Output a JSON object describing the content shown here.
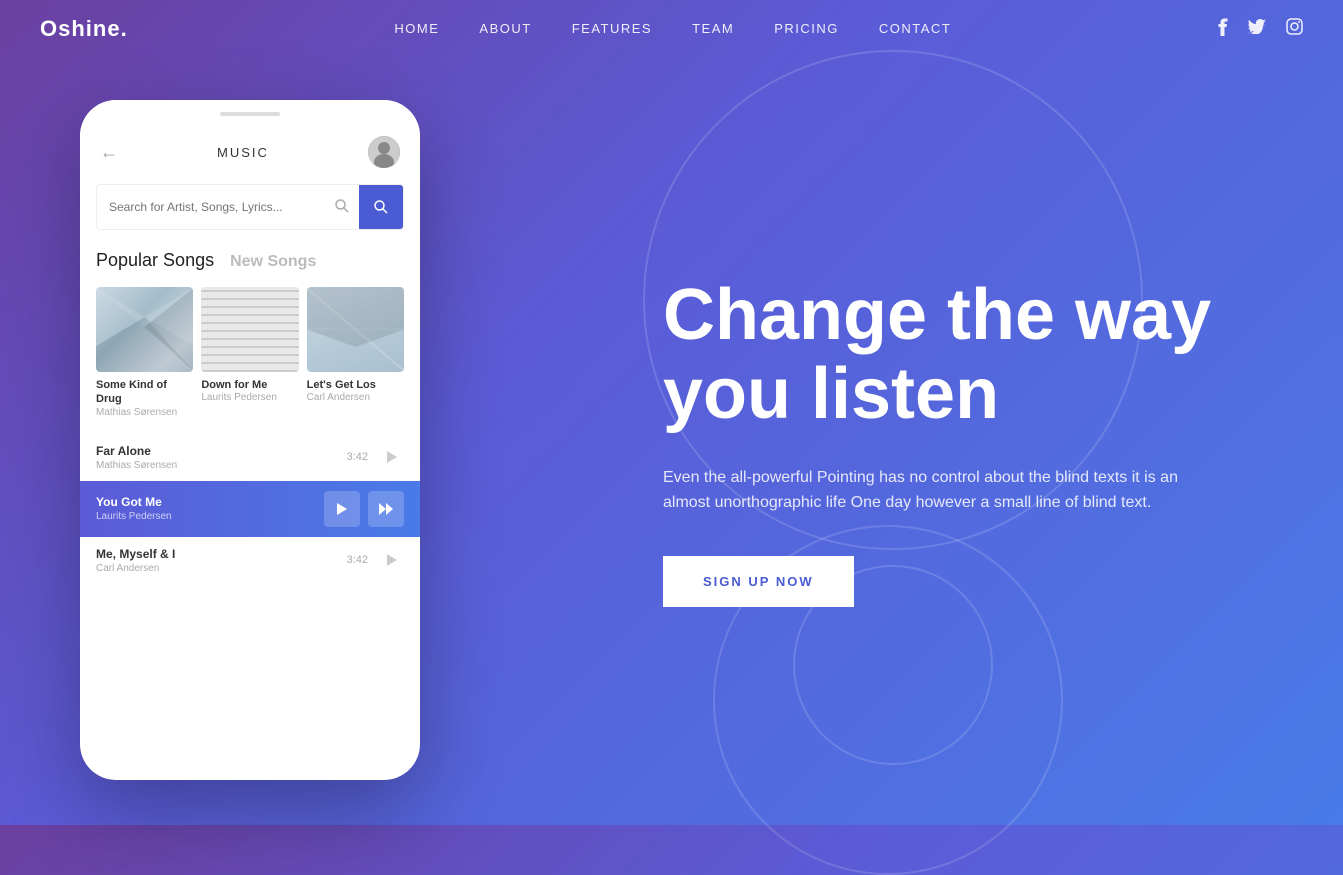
{
  "brand": {
    "logo": "Oshine."
  },
  "nav": {
    "links": [
      {
        "label": "HOME",
        "id": "home"
      },
      {
        "label": "ABOUT",
        "id": "about"
      },
      {
        "label": "FEATURES",
        "id": "features"
      },
      {
        "label": "TEAM",
        "id": "team"
      },
      {
        "label": "PRICING",
        "id": "pricing"
      },
      {
        "label": "CONTACT",
        "id": "contact"
      }
    ],
    "social": [
      {
        "icon": "f",
        "name": "facebook-icon"
      },
      {
        "icon": "t",
        "name": "twitter-icon"
      },
      {
        "icon": "i",
        "name": "instagram-icon"
      }
    ]
  },
  "phone": {
    "header_title": "MUSIC",
    "search_placeholder": "Search for Artist, Songs, Lyrics...",
    "tab_popular_bold": "Popular",
    "tab_popular_light": " Songs",
    "tab_new_bold": "New",
    "tab_new_light": " Songs",
    "cards": [
      {
        "title_bold": "Some",
        "title_rest": " Kind of Drug",
        "artist": "Mathias Sørensen"
      },
      {
        "title_bold": "Down",
        "title_rest": " for Me",
        "artist": "Laurits Pedersen"
      },
      {
        "title_bold": "Let's",
        "title_rest": " Get Los",
        "artist": "Carl Andersen"
      }
    ],
    "playlist": [
      {
        "name_bold": "Far",
        "name_rest": " Alone",
        "artist": "Mathias Sørensen",
        "duration": "3:42",
        "active": false
      },
      {
        "name_bold": "You",
        "name_rest": " Got Me",
        "artist": "Laurits Pedersen",
        "duration": "",
        "active": true
      },
      {
        "name_bold": "Me,",
        "name_rest": " Myself & I",
        "artist": "Carl Andersen",
        "duration": "3:42",
        "active": false
      }
    ]
  },
  "hero": {
    "title_line1": "Change the way",
    "title_line2": "you listen",
    "description": "Even the all-powerful Pointing has no control about the blind texts it is an almost unorthographic life One day however a small line of blind text.",
    "cta_label": "SIGN UP NOW"
  }
}
